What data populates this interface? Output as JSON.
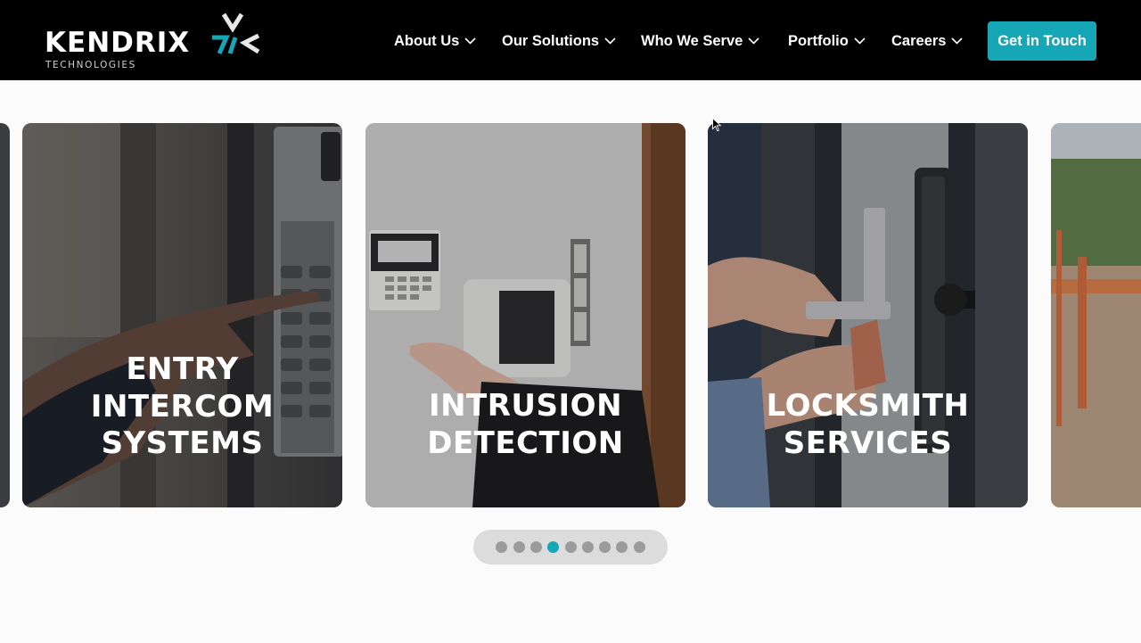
{
  "brand": {
    "name": "KENDRIX",
    "tagline": "TECHNOLOGIES",
    "accent_color": "#16a7b6"
  },
  "nav": {
    "items": [
      {
        "label": "About Us",
        "icon": "chevron-down-icon"
      },
      {
        "label": "Our Solutions",
        "icon": "chevron-down-icon"
      },
      {
        "label": "Who We Serve",
        "icon": "chevron-down-icon"
      },
      {
        "label": "Portfolio",
        "icon": "chevron-down-icon"
      },
      {
        "label": "Careers",
        "icon": "chevron-down-icon"
      }
    ],
    "cta_label": "Get in Touch"
  },
  "carousel": {
    "cards": [
      {
        "title": "ENTRY\nINTERCOM\nSYSTEMS",
        "image": "hand pressing intercom keypad"
      },
      {
        "title": "INTRUSION\nDETECTION",
        "image": "finger pressing alarm keypad"
      },
      {
        "title": "LOCKSMITH\nSERVICES",
        "image": "locksmith replacing door cylinder lock"
      },
      {
        "title": "",
        "image": "parking gate barrier (partially visible)"
      }
    ],
    "pagination": {
      "total": 9,
      "active_index": 3
    }
  }
}
